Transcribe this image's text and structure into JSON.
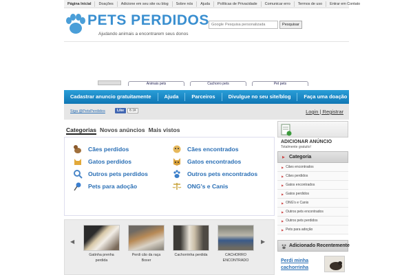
{
  "top_nav": [
    "Página Inicial",
    "Doações",
    "Adicione em seu site ou blog",
    "Sobre nós",
    "Ajuda",
    "Políticas de Privacidade",
    "Comunicar erro",
    "Termos de uso",
    "Entrar em Contato"
  ],
  "logo": {
    "title": "PETS PERDIDOS",
    "subtitle": "Ajudando animais a encontrarem seus donos"
  },
  "search": {
    "brand": "Google",
    "placeholder": "Pesquisa personalizada",
    "button": "Pesquisar"
  },
  "ad_links": [
    "Animais pets",
    "Cachorro pets",
    "Pet pets"
  ],
  "main_nav": [
    "Cadastrar anuncio gratuitamente",
    "Ajuda",
    "Parceiros",
    "Divulgue no seu site/blog",
    "Faça uma doação"
  ],
  "sub_bar": {
    "follow": "Siga @PetsPerdidos",
    "fb_like": "Like",
    "fb_count": "8.1K",
    "login": "Login | Registrar"
  },
  "tabs": [
    "Categorias",
    "Novos anúncios",
    "Mais vistos"
  ],
  "categories_left": [
    {
      "label": "Cães perdidos",
      "icon": "dog-icon"
    },
    {
      "label": "Gatos perdidos",
      "icon": "cat-icon"
    },
    {
      "label": "Outros pets perdidos",
      "icon": "magnifier-icon"
    },
    {
      "label": "Pets para adoção",
      "icon": "pin-icon"
    }
  ],
  "categories_right": [
    {
      "label": "Cães encontrados",
      "icon": "dog-face-icon"
    },
    {
      "label": "Gatos encontrados",
      "icon": "cat-face-icon"
    },
    {
      "label": "Outros pets encontrados",
      "icon": "paw-icon"
    },
    {
      "label": "ONG's e Canis",
      "icon": "scales-icon"
    }
  ],
  "gallery": [
    {
      "caption": "Gatinha prenha perdida"
    },
    {
      "caption": "Perdi cão da raça Boxer"
    },
    {
      "caption": "Cachorrinha perdida"
    },
    {
      "caption": "CACHORRO ENCONTRADO"
    }
  ],
  "sidebar": {
    "add_title": "ADICIONAR ANÚNCIO",
    "add_subtitle": "Totalmente gratuito!",
    "category_heading": "Categoria",
    "categories": [
      "Cães encontrados",
      "Cães perdidos",
      "Gatos encontrados",
      "Gatos perdidos",
      "ONG's e Canis",
      "Outros pets encontrados",
      "Outros pets perdidos",
      "Pets para adoção"
    ],
    "recent_heading": "Adicionado Recentemente",
    "recent_item": "Perdi minha cachorrinha"
  },
  "colors": {
    "brand_blue": "#2a6fb5",
    "nav_blue": "#1a88c8"
  }
}
